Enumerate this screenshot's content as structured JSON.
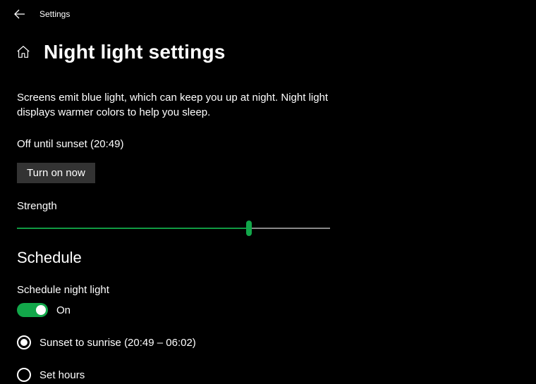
{
  "app": {
    "title": "Settings"
  },
  "page": {
    "title": "Night light settings",
    "description": "Screens emit blue light, which can keep you up at night. Night light displays warmer colors to help you sleep.",
    "status": "Off until sunset (20:49)",
    "turn_on_button": "Turn on now",
    "strength_label": "Strength",
    "strength_value": 74
  },
  "schedule": {
    "section_title": "Schedule",
    "label": "Schedule night light",
    "toggle_state": "On",
    "options": {
      "sunset": "Sunset to sunrise (20:49 – 06:02)",
      "set_hours": "Set hours"
    },
    "selected": "sunset"
  },
  "colors": {
    "accent": "#12a74a"
  }
}
